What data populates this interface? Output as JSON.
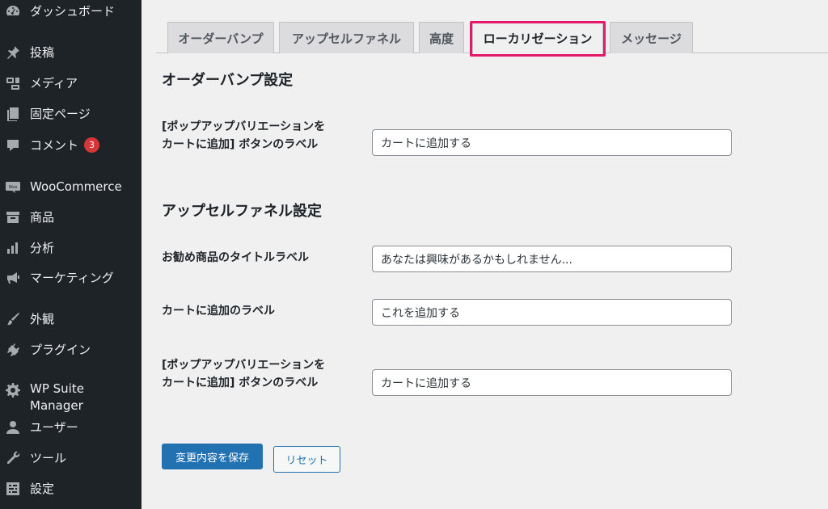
{
  "sidebar": {
    "items": [
      {
        "label": "ダッシュボード",
        "icon": "dashboard-icon"
      },
      {
        "label": "投稿",
        "icon": "pin-icon"
      },
      {
        "label": "メディア",
        "icon": "media-icon"
      },
      {
        "label": "固定ページ",
        "icon": "page-icon"
      },
      {
        "label": "コメント",
        "icon": "comment-icon",
        "badge": "3"
      },
      {
        "label": "WooCommerce",
        "icon": "woo-icon"
      },
      {
        "label": "商品",
        "icon": "archive-icon"
      },
      {
        "label": "分析",
        "icon": "bar-chart-icon"
      },
      {
        "label": "マーケティング",
        "icon": "megaphone-icon"
      },
      {
        "label": "外観",
        "icon": "brush-icon"
      },
      {
        "label": "プラグイン",
        "icon": "plug-icon"
      },
      {
        "label": "WP Suite Manager",
        "icon": "gear-icon"
      },
      {
        "label": "ユーザー",
        "icon": "user-icon"
      },
      {
        "label": "ツール",
        "icon": "wrench-icon"
      },
      {
        "label": "設定",
        "icon": "settings-icon"
      }
    ]
  },
  "tabs": [
    {
      "label": "オーダーバンプ",
      "active": false
    },
    {
      "label": "アップセルファネル",
      "active": false
    },
    {
      "label": "高度",
      "active": false
    },
    {
      "label": "ローカリゼーション",
      "active": true
    },
    {
      "label": "メッセージ",
      "active": false
    }
  ],
  "sections": {
    "order_bump": {
      "title": "オーダーバンプ設定",
      "fields": [
        {
          "label": "[ポップアップバリエーションをカートに追加] ボタンのラベル",
          "value": "カートに追加する"
        }
      ]
    },
    "upsell": {
      "title": "アップセルファネル設定",
      "fields": [
        {
          "label": "お勧め商品のタイトルラベル",
          "value": "あなたは興味があるかもしれません..."
        },
        {
          "label": "カートに追加のラベル",
          "value": "これを追加する"
        },
        {
          "label": "[ポップアップバリエーションをカートに追加] ボタンのラベル",
          "value": "カートに追加する"
        }
      ]
    }
  },
  "actions": {
    "save_label": "変更内容を保存",
    "reset_label": "リセット"
  },
  "colors": {
    "sidebar_bg": "#1d2327",
    "primary": "#2271b1",
    "highlight": "#e5186a",
    "badge": "#d63638"
  }
}
